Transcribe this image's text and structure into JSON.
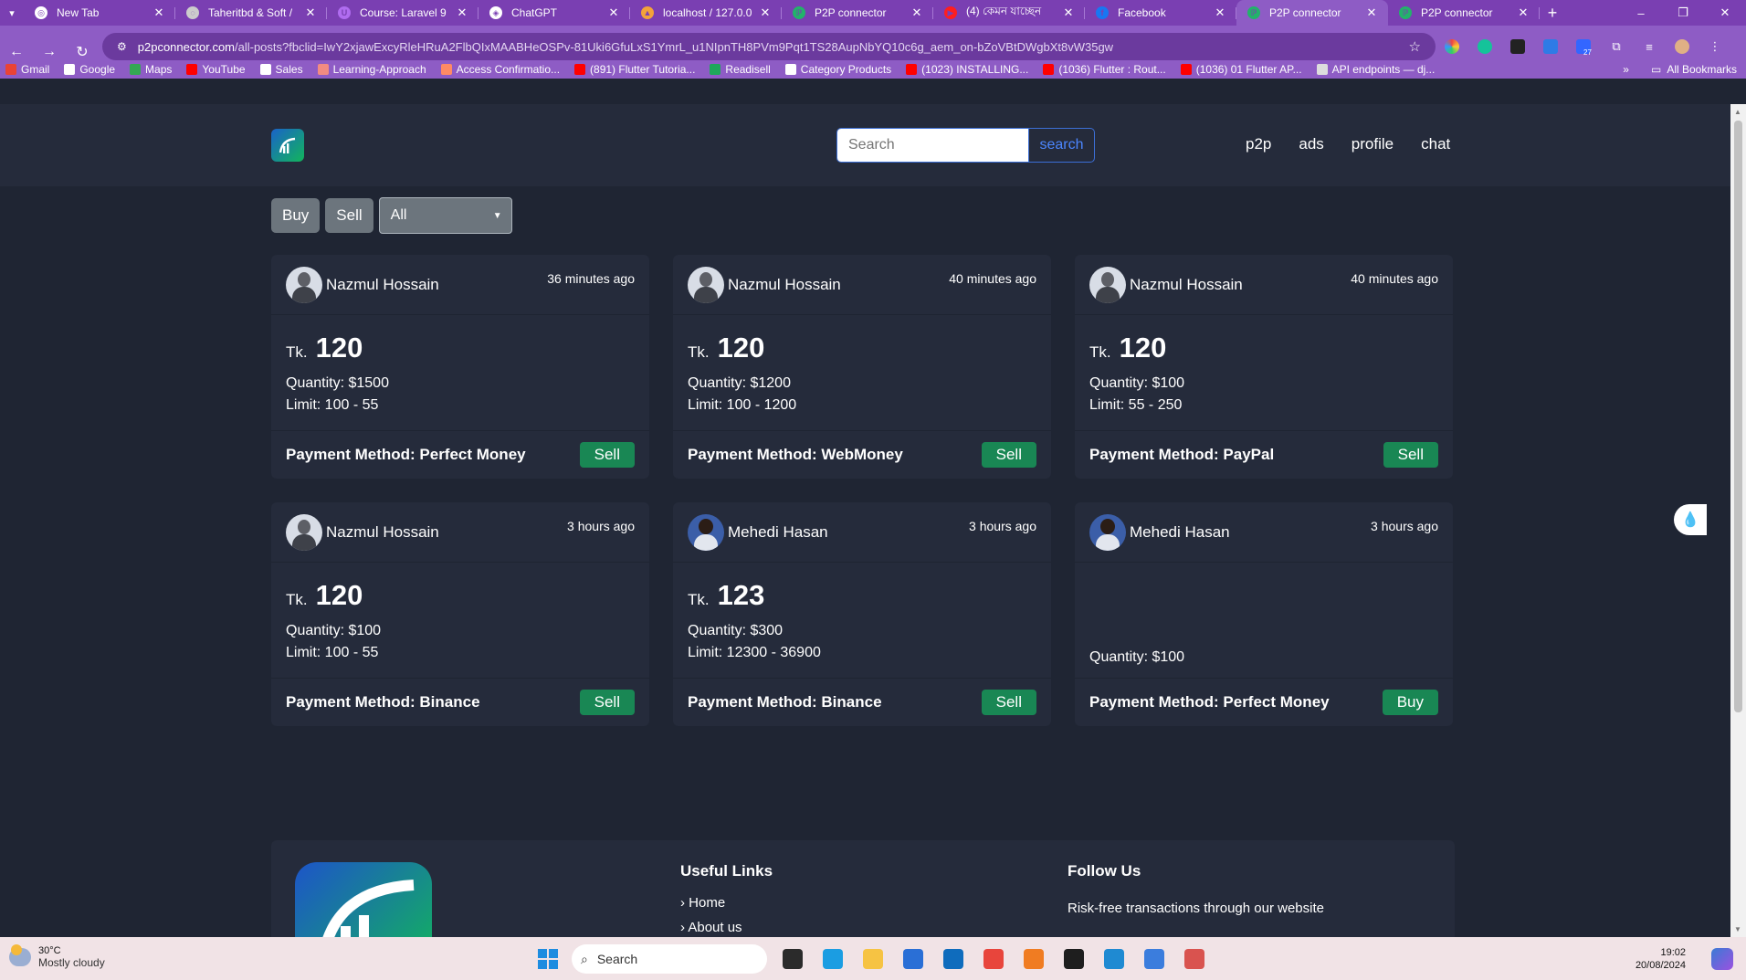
{
  "browser": {
    "tabs": [
      {
        "label": "New Tab",
        "color": "#ffffff",
        "glyph": "◎",
        "active": false
      },
      {
        "label": "Taheritbd & Soft /",
        "color": "#cccccc",
        "glyph": "◌",
        "active": false
      },
      {
        "label": "Course: Laravel 9",
        "color": "#b06cf0",
        "glyph": "U",
        "active": false
      },
      {
        "label": "ChatGPT",
        "color": "#ffffff",
        "glyph": "◈",
        "active": false
      },
      {
        "label": "localhost / 127.0.0",
        "color": "#f3a33a",
        "glyph": "▲",
        "active": false
      },
      {
        "label": "P2P connector",
        "color": "#22b36a",
        "glyph": "ℙ",
        "active": false
      },
      {
        "label": "(4) কেমন যাচ্ছেন",
        "color": "#ff1e1e",
        "glyph": "▶",
        "active": false
      },
      {
        "label": "Facebook",
        "color": "#1877f2",
        "glyph": "f",
        "active": false
      },
      {
        "label": "P2P connector",
        "color": "#22b36a",
        "glyph": "ℙ",
        "active": true
      },
      {
        "label": "P2P connector",
        "color": "#22b36a",
        "glyph": "ℙ",
        "active": false
      }
    ],
    "url_domain": "p2pconnector.com",
    "url_path": "/all-posts?fbclid=IwY2xjawExcyRleHRuA2FlbQIxMAABHeOSPv-81Uki6GfuLxS1YmrL_u1NIpnTH8PVm9Pqt1TS28AupNbYQ10c6g_aem_on-bZoVBtDWgbXt8vW35gw",
    "bookmarks": [
      {
        "label": "Gmail",
        "color": "#ea4335"
      },
      {
        "label": "Google",
        "color": "#ffffff"
      },
      {
        "label": "Maps",
        "color": "#34a853"
      },
      {
        "label": "YouTube",
        "color": "#ff0000"
      },
      {
        "label": "Sales",
        "color": "#ffffff"
      },
      {
        "label": "Learning-Approach",
        "color": "#f28b82"
      },
      {
        "label": "Access Confirmatio...",
        "color": "#ff8a65"
      },
      {
        "label": "(891) Flutter Tutoria...",
        "color": "#ff0000"
      },
      {
        "label": "Readisell",
        "color": "#1ea85a"
      },
      {
        "label": "Category Products",
        "color": "#ffffff"
      },
      {
        "label": "(1023) INSTALLING...",
        "color": "#ff0000"
      },
      {
        "label": "(1036) Flutter : Rout...",
        "color": "#ff0000"
      },
      {
        "label": "(1036) 01 Flutter AP...",
        "color": "#ff0000"
      },
      {
        "label": "API endpoints — dj...",
        "color": "#dddddd"
      }
    ],
    "all_bookmarks_label": "All Bookmarks",
    "extension_badge": "27"
  },
  "site": {
    "search_placeholder": "Search",
    "search_button": "search",
    "nav": [
      "p2p",
      "ads",
      "profile",
      "chat"
    ],
    "filter_buy": "Buy",
    "filter_sell": "Sell",
    "filter_select_value": "All",
    "currency_label": "Tk.",
    "posts": [
      {
        "user": "Nazmul Hossain",
        "time": "36 minutes ago",
        "price": "120",
        "quantity": "Quantity: $1500",
        "limit": "Limit: 100 - 55",
        "payment": "Payment Method: Perfect Money",
        "action": "Sell",
        "avatar": "light"
      },
      {
        "user": "Nazmul Hossain",
        "time": "40 minutes ago",
        "price": "120",
        "quantity": "Quantity: $1200",
        "limit": "Limit: 100 - 1200",
        "payment": "Payment Method: WebMoney",
        "action": "Sell",
        "avatar": "light"
      },
      {
        "user": "Nazmul Hossain",
        "time": "40 minutes ago",
        "price": "120",
        "quantity": "Quantity: $100",
        "limit": "Limit: 55 - 250",
        "payment": "Payment Method: PayPal",
        "action": "Sell",
        "avatar": "light"
      },
      {
        "user": "Nazmul Hossain",
        "time": "3 hours ago",
        "price": "120",
        "quantity": "Quantity: $100",
        "limit": "Limit: 100 - 55",
        "payment": "Payment Method: Binance",
        "action": "Sell",
        "avatar": "light"
      },
      {
        "user": "Mehedi Hasan",
        "time": "3 hours ago",
        "price": "123",
        "quantity": "Quantity: $300",
        "limit": "Limit: 12300 - 36900",
        "payment": "Payment Method: Binance",
        "action": "Sell",
        "avatar": "dark"
      },
      {
        "user": "Mehedi Hasan",
        "time": "3 hours ago",
        "price": null,
        "quantity": "Quantity: $100",
        "limit": null,
        "payment": "Payment Method: Perfect Money",
        "action": "Buy",
        "avatar": "dark"
      }
    ],
    "footer": {
      "useful_links_title": "Useful Links",
      "links": [
        "Home",
        "About us"
      ],
      "follow_title": "Follow Us",
      "follow_text": "Risk-free transactions through our website"
    },
    "accent_color": "#198754"
  },
  "taskbar": {
    "temperature": "30°C",
    "weather": "Mostly cloudy",
    "search_label": "Search",
    "time": "19:02",
    "date": "20/08/2024",
    "apps": [
      {
        "name": "file-manager-icon",
        "color": "#2b2b2b"
      },
      {
        "name": "edge-icon",
        "color": "#1b9de2"
      },
      {
        "name": "folder-icon",
        "color": "#f6c343"
      },
      {
        "name": "store-icon",
        "color": "#2a6fd6"
      },
      {
        "name": "outlook-icon",
        "color": "#0f6cbd"
      },
      {
        "name": "chrome-icon",
        "color": "#e8453c"
      },
      {
        "name": "xampp-icon",
        "color": "#f07c22"
      },
      {
        "name": "terminal-icon",
        "color": "#1e1e1e"
      },
      {
        "name": "vscode-icon",
        "color": "#1f8ad2"
      },
      {
        "name": "notepad-icon",
        "color": "#3b7ddd"
      },
      {
        "name": "snipping-tool-icon",
        "color": "#d9534f"
      }
    ]
  }
}
